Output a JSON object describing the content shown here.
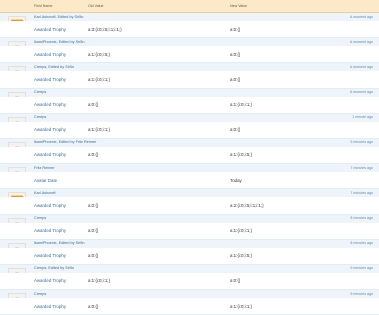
{
  "columns": {
    "field_name": "Field Name",
    "old_value": "Old Value",
    "new_value": "New Value"
  },
  "entries": [
    {
      "who": "Karl Ashcroft, Edited by Sir5n",
      "when": "A moment ago",
      "field": "Awarded Trophy",
      "old": "a:3:{i:0;i:5;i:1;i:1;}",
      "new": "a:0:{}",
      "avatar": "burger-avatar-icon"
    },
    {
      "who": "ikamiPhoenix, Edited by Sir5n",
      "when": "A moment ago",
      "field": "Awarded Trophy",
      "old": "a:1:{i:0;i:5;}",
      "new": "a:0:{}",
      "avatar": "default-avatar-icon"
    },
    {
      "who": "Creeps, Edited by Sir5n",
      "when": "A moment ago",
      "field": "Awarded Trophy",
      "old": "a:1:{i:0;i:1;}",
      "new": "a:0:{}",
      "avatar": "default-avatar-icon"
    },
    {
      "who": "Creeps",
      "when": "A moment ago",
      "field": "Awarded Trophy",
      "old": "a:0:{}",
      "new": "a:1:{i:0;i:1;}",
      "avatar": "default-avatar-icon"
    },
    {
      "who": "Creeps",
      "when": "1 minute ago",
      "field": "Awarded Trophy",
      "old": "a:1:{i:0;i:1;}",
      "new": "a:0:{}",
      "avatar": "default-avatar-icon"
    },
    {
      "who": "ikamiPhoenix, Edited by Fritz Reimer",
      "when": "5 minutes ago",
      "field": "Awarded Trophy",
      "old": "a:0:{}",
      "new": "a:1:{i:0;i:5;}",
      "avatar": "default-avatar-icon"
    },
    {
      "who": "Fritz Reimer",
      "when": "7 minutes ago",
      "field": "Avatar Date",
      "old": "",
      "new": "Today",
      "avatar": "default-avatar-icon"
    },
    {
      "who": "Karl Ashcroft",
      "when": "7 minutes ago",
      "field": "Awarded Trophy",
      "old": "a:0:{}",
      "new": "a:2:{i:0;i:5;i:1;i:1;}",
      "avatar": "burger-avatar-icon"
    },
    {
      "who": "Creeps",
      "when": "8 minutes ago",
      "field": "Awarded Trophy",
      "old": "a:0:{}",
      "new": "a:1:{i:0;i:1;}",
      "avatar": "default-avatar-icon"
    },
    {
      "who": "ikamiPhoenix, Edited by Sir5n",
      "when": "8 minutes ago",
      "field": "Awarded Trophy",
      "old": "a:0:{}",
      "new": "a:1:{i:0;i:5;}",
      "avatar": "default-avatar-icon"
    },
    {
      "who": "Creeps, Edited by Sir5n",
      "when": "9 minutes ago",
      "field": "Awarded Trophy",
      "old": "a:1:{i:0;i:1;}",
      "new": "a:0:{}",
      "avatar": "default-avatar-icon"
    },
    {
      "who": "Creeps",
      "when": "9 minutes ago",
      "field": "Awarded Trophy",
      "old": "a:0:{}",
      "new": "a:1:{i:0;i:1;}",
      "avatar": "default-avatar-icon"
    }
  ]
}
